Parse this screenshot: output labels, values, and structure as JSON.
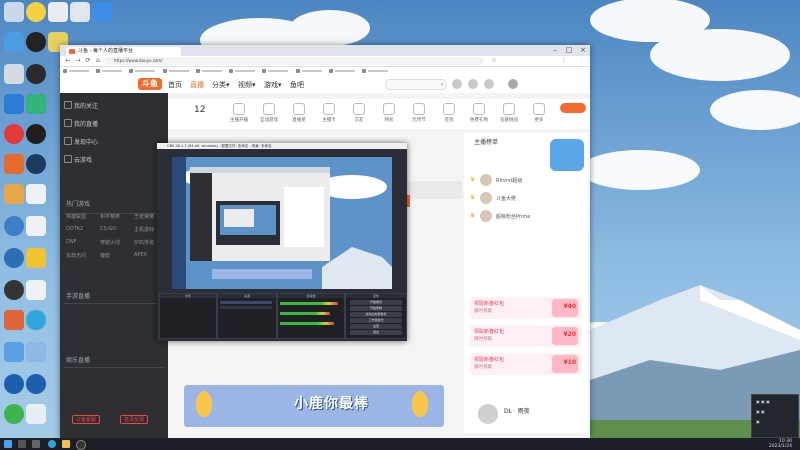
{
  "browser": {
    "tab_title": "斗鱼 - 每个人的直播平台",
    "url": "https://www.douyu.com/"
  },
  "site": {
    "logo": "斗鱼",
    "nav": [
      "首页",
      "直播",
      "分类▾",
      "视频▾",
      "游戏▾",
      "鱼吧"
    ],
    "search_icon": "⌕"
  },
  "sidebar": {
    "items": [
      "我的关注",
      "我的直播",
      "发现中心",
      "云游戏"
    ],
    "section_hot": "热门游戏",
    "games": [
      "英雄联盟",
      "和平精英",
      "王者荣耀",
      "DOTA2",
      "CS:GO",
      "主机游戏",
      "DNF",
      "穿越火线",
      "炉石传说",
      "永劫无间",
      "魔兽",
      "APEX"
    ],
    "section_mobile": "手游直播",
    "section_ent": "娱乐直播",
    "footer_btn_left": "斗鱼客服",
    "footer_btn_right": "意见反馈"
  },
  "content": {
    "category_count": "12",
    "categories": [
      "主播开播",
      "互动游戏",
      "直播星",
      "主播卡",
      "交友",
      "特权",
      "元宵节",
      "签到",
      "免费礼物",
      "答题挑战",
      "更多"
    ],
    "rank_title": "主播榜单",
    "rank": [
      "Ritvrst超级",
      "斗鱼大佬",
      "超级粉丝Prime"
    ],
    "gift_cards": [
      {
        "title": "领取新春红包",
        "sub": "限时领取",
        "value": "¥40"
      },
      {
        "title": "领取新春红包",
        "sub": "限时领取",
        "value": "¥20"
      },
      {
        "title": "领取新春红包",
        "sub": "限时领取",
        "value": "¥10"
      }
    ],
    "banner_text": "小鹿你最棒",
    "streamer_name": "DL · 雨夜"
  },
  "obs": {
    "title": "OBS 28.1.2 (64-bit, windows) - 配置文件: 未命名 - 场景: 未命名",
    "docks": [
      "场景",
      "来源",
      "混音器",
      "转场特效",
      "控件"
    ],
    "controls": [
      "开始推流",
      "开始录制",
      "启动虚拟摄像机",
      "工作室模式",
      "设置",
      "退出"
    ]
  },
  "taskbar": {
    "time": "10:30",
    "date": "2023/1/24"
  },
  "colors": {
    "accent": "#f46c2b",
    "sidebar_bg": "#2d2f33",
    "obs_bg": "#2b2e37"
  }
}
